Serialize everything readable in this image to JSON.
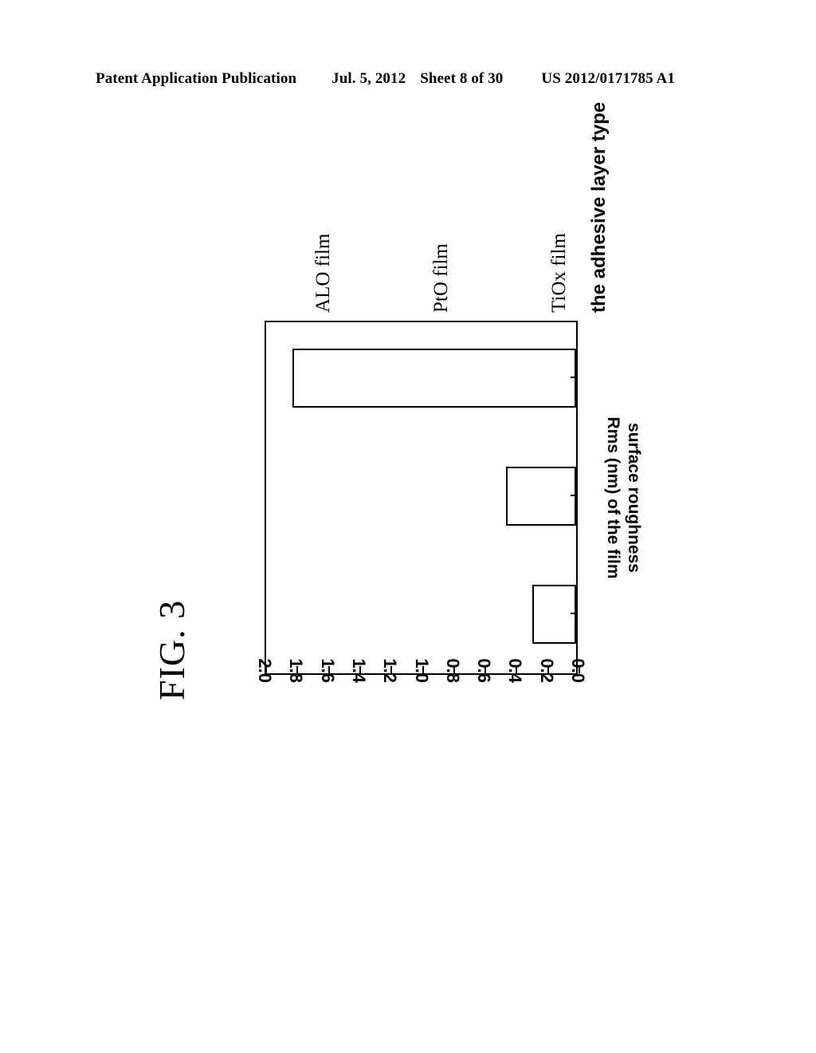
{
  "header": {
    "publication": "Patent Application Publication",
    "date": "Jul. 5, 2012",
    "sheet": "Sheet 8 of 30",
    "patent_number": "US 2012/0171785 A1"
  },
  "figure": {
    "caption": "FIG. 3"
  },
  "chart_data": {
    "type": "bar",
    "orientation": "vertical",
    "title": "",
    "categories": [
      "ALO film",
      "PtO film",
      "TiOx film"
    ],
    "values": [
      0.28,
      0.45,
      1.81
    ],
    "xlabel": "the adhesive layer type",
    "ylabel_line1": "surface roughness",
    "ylabel_line2": "Rms (nm) of the film",
    "ylim": [
      0.0,
      2.0
    ],
    "ytick_labels": [
      "0.0",
      "0.2",
      "0.4",
      "0.6",
      "0.8",
      "1.0",
      "1.2",
      "1.4",
      "1.6",
      "1.8",
      "2.0"
    ],
    "ytick_values": [
      0.0,
      0.2,
      0.4,
      0.6,
      0.8,
      1.0,
      1.2,
      1.4,
      1.6,
      1.8,
      2.0
    ],
    "grid": false,
    "legend": false,
    "bar_fill": "#ffffff",
    "bar_edge": "#000000"
  },
  "colors": {
    "ink": "#000000",
    "paper": "#ffffff"
  }
}
